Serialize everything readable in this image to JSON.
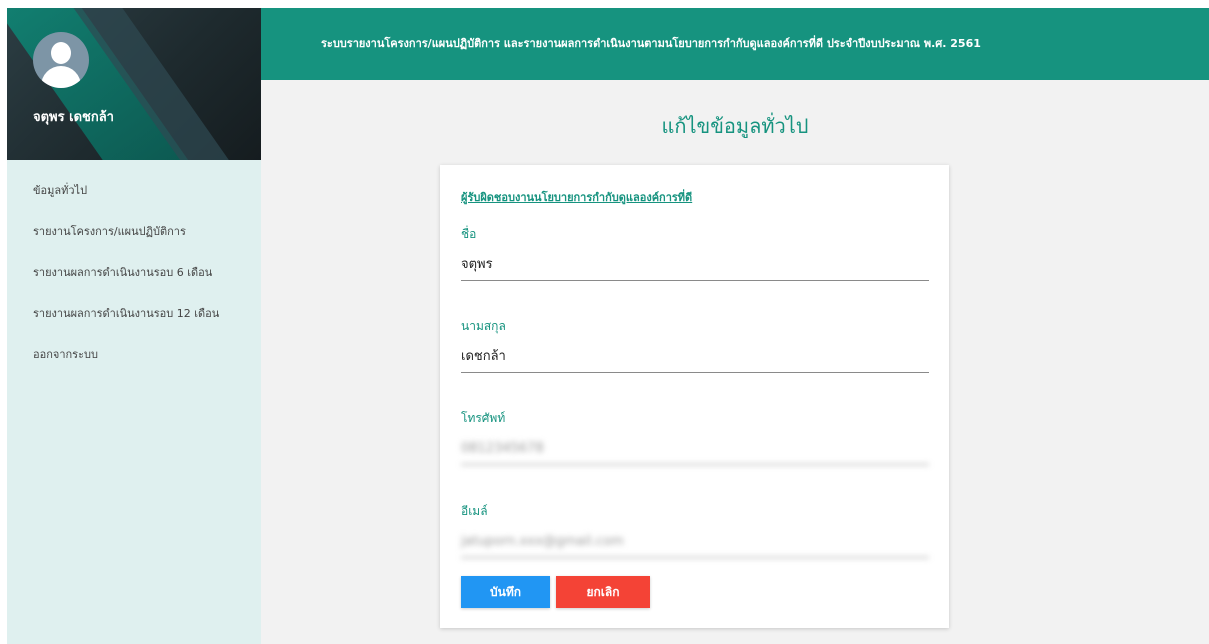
{
  "sidebar": {
    "user_name": "จตุพร เดชกล้า",
    "items": [
      {
        "label": "ข้อมูลทั่วไป"
      },
      {
        "label": "รายงานโครงการ/แผนปฏิบัติการ"
      },
      {
        "label": "รายงานผลการดำเนินงานรอบ 6 เดือน"
      },
      {
        "label": "รายงานผลการดำเนินงานรอบ 12 เดือน"
      },
      {
        "label": "ออกจากระบบ"
      }
    ]
  },
  "header": {
    "title": "ระบบรายงานโครงการ/แผนปฏิบัติการ และรายงานผลการดำเนินงานตามนโยบายการกำกับดูแลองค์การที่ดี ประจำปีงบประมาณ พ.ศ. 2561"
  },
  "main": {
    "page_title": "แก้ไขข้อมูลทั่วไป",
    "section_link": "ผู้รับผิดชอบงานนโยบายการกำกับดูแลองค์การที่ดี",
    "fields": {
      "first_name": {
        "label": "ชื่อ",
        "value": "จตุพร"
      },
      "last_name": {
        "label": "นามสกุล",
        "value": "เดชกล้า"
      },
      "phone": {
        "label": "โทรศัพท์",
        "value": "0812345678"
      },
      "email": {
        "label": "อีเมล์",
        "value": "jatuporn.xxx@gmail.com"
      }
    },
    "buttons": {
      "save": "บันทึก",
      "cancel": "ยกเลิก"
    }
  },
  "colors": {
    "accent": "#16937f",
    "save": "#2196f3",
    "cancel": "#f44336",
    "sidebar_bg": "#dff0ef"
  }
}
